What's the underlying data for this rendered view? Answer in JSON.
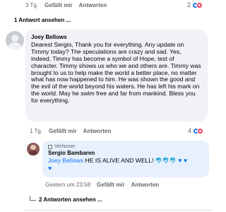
{
  "top_row": {
    "time": "3 Tg.",
    "like": "Gefällt mir",
    "reply": "Antworten",
    "reaction_count": "2"
  },
  "top_replies_link": "1 Antwort ansehen ...",
  "main_comment": {
    "author": "Joey Bellows",
    "text": "Dearest Sergio, Thank you for everything. Any update on Timmy today? The speculations are crazy and sad. Yes, indeed, Timmy has become a symbol of Hope, test of character. Timmy shows us who we and others are. Timmy was brought to us to help make the world a better place, no matter what has now happened to him. He was shown the good and the evil of the world beyond his waters. He has left his mark on the world. May he swim free and far from mankind. Bless you for everything.",
    "time": "1 Tg.",
    "like": "Gefällt mir",
    "reply": "Antworten",
    "reaction_count": "4"
  },
  "reply": {
    "badge": "Verfasser",
    "author": "Sergio Bambaren",
    "mention": "Joey Bellows",
    "text": "HE IS ALIVE AND WELL!",
    "emojis": "🐬🐬🐬",
    "heart1": "♥",
    "heart2": "♥",
    "heart3": "♥",
    "time": "Gestern um 23:58",
    "like": "Gefällt mir",
    "reply": "Antworten"
  },
  "bottom_replies_link": "2 Antworten ansehen ...",
  "colors": {
    "link_blue": "#1877f2",
    "bubble_gray": "#f0f2f5",
    "reply_blue": "#e7f0fd"
  }
}
